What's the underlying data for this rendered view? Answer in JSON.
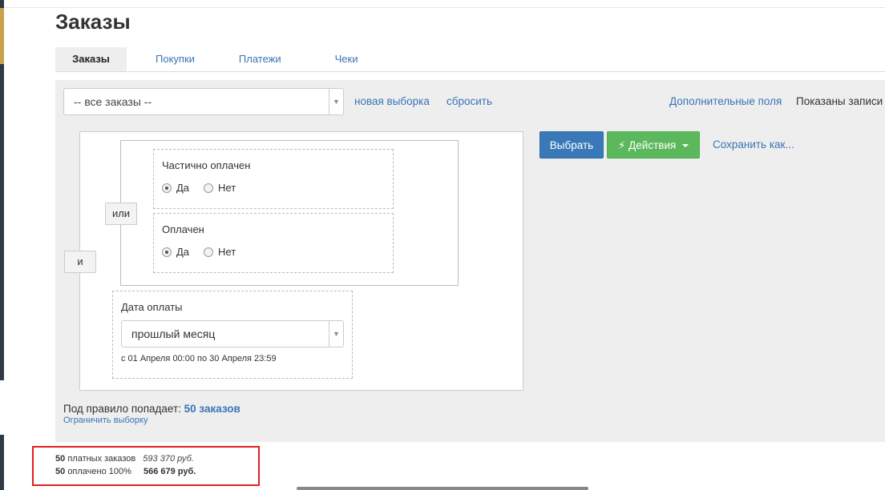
{
  "page": {
    "title": "Заказы"
  },
  "tabs": [
    {
      "label": "Заказы"
    },
    {
      "label": "Покупки"
    },
    {
      "label": "Платежи"
    },
    {
      "label": "Чеки"
    }
  ],
  "toolbar": {
    "selection_value": "-- все заказы --",
    "new_selection": "новая выборка",
    "reset": "сбросить",
    "extra_fields": "Дополнительные поля",
    "shown_records": "Показаны записи"
  },
  "rules": {
    "and_label": "и",
    "or_label": "или",
    "conditions": [
      {
        "label": "Частично оплачен",
        "yes": "Да",
        "no": "Нет",
        "selected": "yes"
      },
      {
        "label": "Оплачен",
        "yes": "Да",
        "no": "Нет",
        "selected": "yes"
      }
    ],
    "date": {
      "label": "Дата оплаты",
      "value": "прошлый месяц",
      "range_note": "с 01 Апреля 00:00 по 30 Апреля 23:59"
    }
  },
  "actions": {
    "select": "Выбрать",
    "actions": "Действия",
    "save_as": "Сохранить как..."
  },
  "summary": {
    "prefix": "Под правило попадает:",
    "count": "50 заказов",
    "limit_link": "Ограничить выборку"
  },
  "stats": [
    {
      "count": "50",
      "label": "платных заказов",
      "sum": "593 370 руб."
    },
    {
      "count": "50",
      "label": "оплачено 100%",
      "sum": "566 679 руб."
    }
  ],
  "colors": {
    "accent": "#3a74b5",
    "primary_button": "#3a79b7",
    "success_button": "#5cb85c",
    "highlight_box": "#e02020"
  }
}
